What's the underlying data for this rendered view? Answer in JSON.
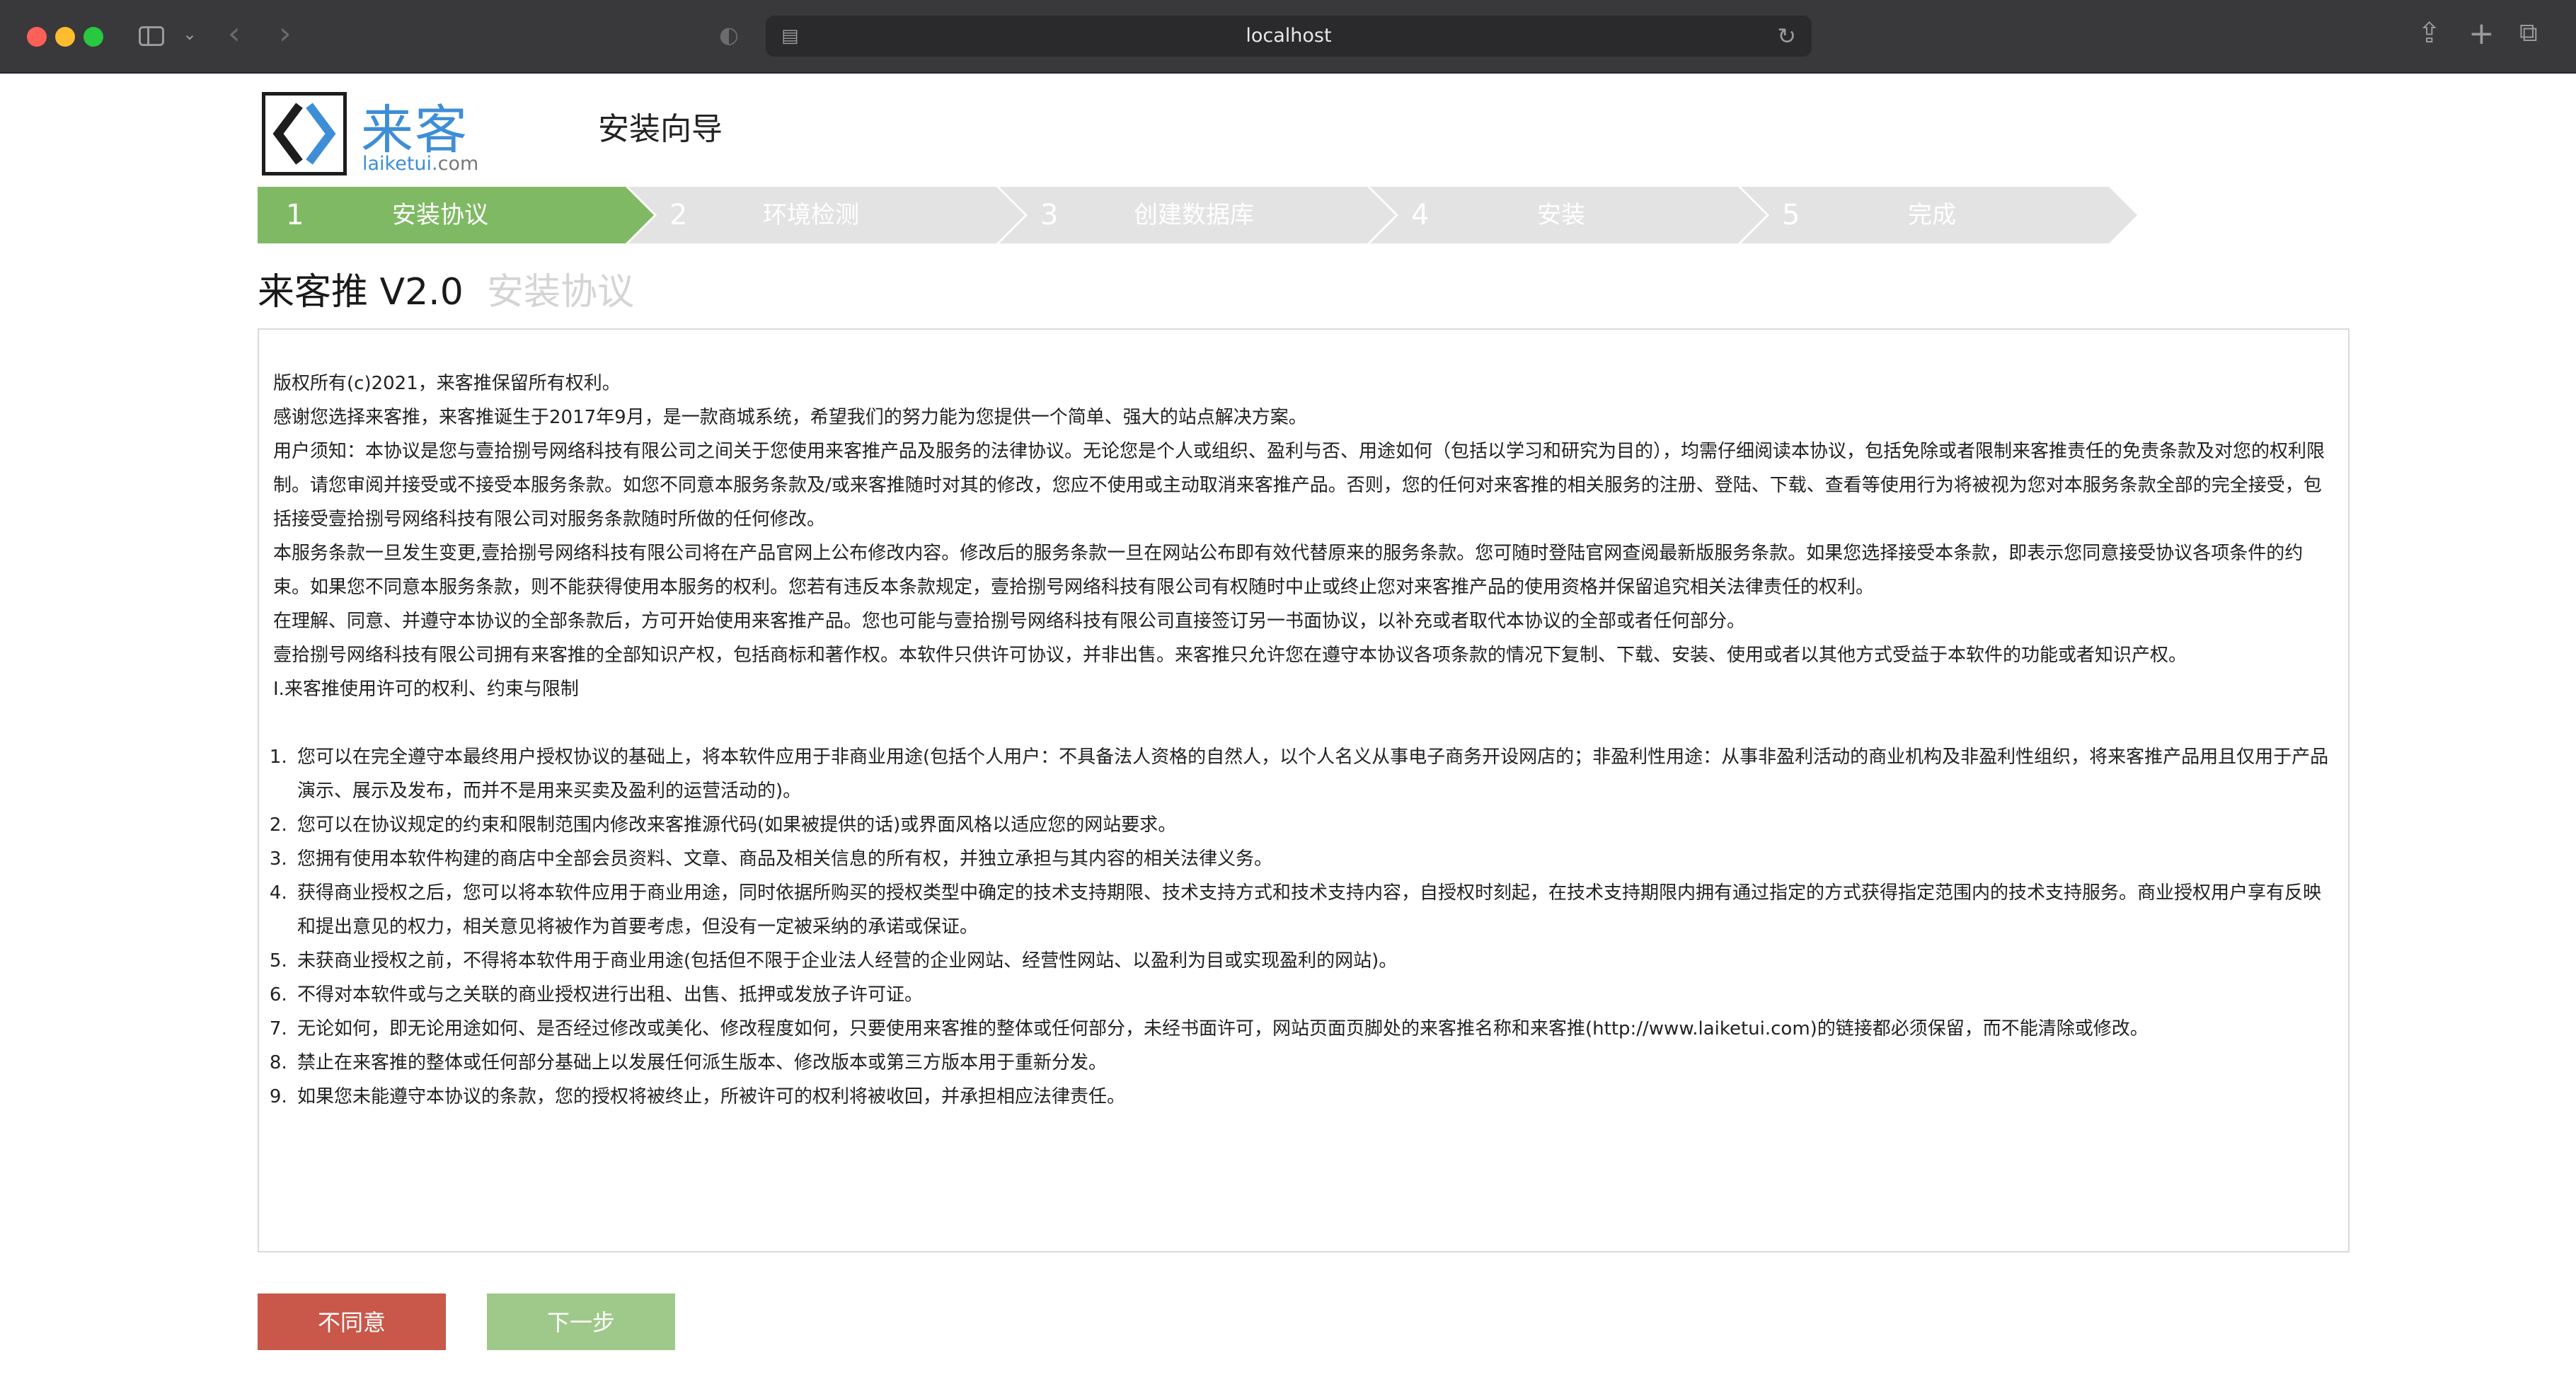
{
  "browser": {
    "address": "localhost"
  },
  "header": {
    "logo_cn": "来客",
    "logo_en_main": "laiketui.",
    "logo_en_tld": "com",
    "wizard_title": "安装向导"
  },
  "steps": [
    {
      "num": "1",
      "label": "安装协议",
      "active": true
    },
    {
      "num": "2",
      "label": "环境检测",
      "active": false
    },
    {
      "num": "3",
      "label": "创建数据库",
      "active": false
    },
    {
      "num": "4",
      "label": "安装",
      "active": false
    },
    {
      "num": "5",
      "label": "完成",
      "active": false
    }
  ],
  "main": {
    "product_title": "来客推 V2.0",
    "section_title": "安装协议"
  },
  "agreement": {
    "paragraphs": [
      "版权所有(c)2021，来客推保留所有权利。",
      "感谢您选择来客推，来客推诞生于2017年9月，是一款商城系统，希望我们的努力能为您提供一个简单、强大的站点解决方案。",
      "用户须知：本协议是您与壹拾捌号网络科技有限公司之间关于您使用来客推产品及服务的法律协议。无论您是个人或组织、盈利与否、用途如何（包括以学习和研究为目的），均需仔细阅读本协议，包括免除或者限制来客推责任的免责条款及对您的权利限制。请您审阅并接受或不接受本服务条款。如您不同意本服务条款及/或来客推随时对其的修改，您应不使用或主动取消来客推产品。否则，您的任何对来客推的相关服务的注册、登陆、下载、查看等使用行为将被视为您对本服务条款全部的完全接受，包括接受壹拾捌号网络科技有限公司对服务条款随时所做的任何修改。",
      "本服务条款一旦发生变更,壹拾捌号网络科技有限公司将在产品官网上公布修改内容。修改后的服务条款一旦在网站公布即有效代替原来的服务条款。您可随时登陆官网查阅最新版服务条款。如果您选择接受本条款，即表示您同意接受协议各项条件的约束。如果您不同意本服务条款，则不能获得使用本服务的权利。您若有违反本条款规定，壹拾捌号网络科技有限公司有权随时中止或终止您对来客推产品的使用资格并保留追究相关法律责任的权利。",
      "在理解、同意、并遵守本协议的全部条款后，方可开始使用来客推产品。您也可能与壹拾捌号网络科技有限公司直接签订另一书面协议，以补充或者取代本协议的全部或者任何部分。",
      "壹拾捌号网络科技有限公司拥有来客推的全部知识产权，包括商标和著作权。本软件只供许可协议，并非出售。来客推只允许您在遵守本协议各项条款的情况下复制、下载、安装、使用或者以其他方式受益于本软件的功能或者知识产权。",
      "I.来客推使用许可的权利、约束与限制"
    ],
    "items": [
      "您可以在完全遵守本最终用户授权协议的基础上，将本软件应用于非商业用途(包括个人用户：不具备法人资格的自然人，以个人名义从事电子商务开设网店的；非盈利性用途：从事非盈利活动的商业机构及非盈利性组织，将来客推产品用且仅用于产品演示、展示及发布，而并不是用来买卖及盈利的运营活动的)。",
      "您可以在协议规定的约束和限制范围内修改来客推源代码(如果被提供的话)或界面风格以适应您的网站要求。",
      "您拥有使用本软件构建的商店中全部会员资料、文章、商品及相关信息的所有权，并独立承担与其内容的相关法律义务。",
      "获得商业授权之后，您可以将本软件应用于商业用途，同时依据所购买的授权类型中确定的技术支持期限、技术支持方式和技术支持内容，自授权时刻起，在技术支持期限内拥有通过指定的方式获得指定范围内的技术支持服务。商业授权用户享有反映和提出意见的权力，相关意见将被作为首要考虑，但没有一定被采纳的承诺或保证。",
      "未获商业授权之前，不得将本软件用于商业用途(包括但不限于企业法人经营的企业网站、经营性网站、以盈利为目或实现盈利的网站)。",
      "不得对本软件或与之关联的商业授权进行出租、出售、抵押或发放子许可证。",
      "无论如何，即无论用途如何、是否经过修改或美化、修改程度如何，只要使用来客推的整体或任何部分，未经书面许可，网站页面页脚处的来客推名称和来客推(http://www.laiketui.com)的链接都必须保留，而不能清除或修改。",
      "禁止在来客推的整体或任何部分基础上以发展任何派生版本、修改版本或第三方版本用于重新分发。",
      "如果您未能遵守本协议的条款，您的授权将被终止，所被许可的权利将被收回，并承担相应法律责任。"
    ]
  },
  "actions": {
    "disagree_label": "不同意",
    "next_label": "下一步"
  }
}
